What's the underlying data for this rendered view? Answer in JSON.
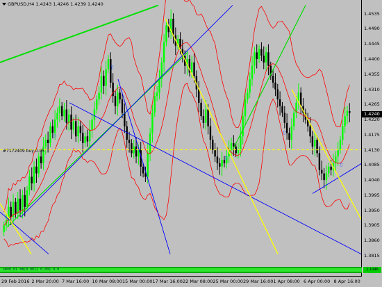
{
  "header": {
    "symbol": "GBPUSD,H4",
    "open": "1.4243",
    "high": "1.4246",
    "low": "1.4239",
    "close": "1.4240"
  },
  "order_label": "#7172409 buy 0.05",
  "current_price": "1.4240",
  "status_text": "sm=0.01 =mL0.0011 0.001 0.0",
  "status_tag": "1.1046",
  "price_axis": {
    "min": 1.3815,
    "max": 1.4555,
    "ticks": [
      "1.4535",
      "1.4490",
      "1.4445",
      "1.4400",
      "1.4355",
      "1.4310",
      "1.4265",
      "1.4220",
      "1.4175",
      "1.4130",
      "1.4085",
      "1.4040",
      "1.3995",
      "1.3950",
      "1.3905",
      "1.3860",
      "1.3815"
    ]
  },
  "time_axis": {
    "ticks": [
      "29 Feb 2016",
      "2 Mar 20:00",
      "7 Mar 16:00",
      "10 Mar 08:00",
      "15 Mar 00:00",
      "17 Mar 16:00",
      "22 Mar 08:00",
      "25 Mar 00:00",
      "29 Mar 16:00",
      "1 Apr 08:00",
      "6 Apr 00:00",
      "8 Apr 16:00"
    ]
  },
  "colors": {
    "background": "#c0c0c0",
    "bull_candle": "#00ff00",
    "bear_candle": "#000000",
    "bollinger": "#ff0000",
    "trend_green": "#00e000",
    "trend_yellow": "#ffff00",
    "trend_blue": "#0000ff",
    "order_line": "#ffff00"
  },
  "chart_data": {
    "type": "candlestick",
    "order_level": 1.413,
    "closes": [
      1.3905,
      1.392,
      1.396,
      1.393,
      1.3975,
      1.394,
      1.3985,
      1.395,
      1.3995,
      1.396,
      1.401,
      1.405,
      1.403,
      1.408,
      1.406,
      1.411,
      1.409,
      1.414,
      1.416,
      1.415,
      1.42,
      1.418,
      1.422,
      1.424,
      1.426,
      1.423,
      1.425,
      1.421,
      1.4235,
      1.419,
      1.4215,
      1.417,
      1.42,
      1.418,
      1.415,
      1.417,
      1.4155,
      1.419,
      1.422,
      1.425,
      1.428,
      1.43,
      1.435,
      1.432,
      1.437,
      1.44,
      1.433,
      1.429,
      1.426,
      1.43,
      1.428,
      1.424,
      1.42,
      1.416,
      1.415,
      1.412,
      1.414,
      1.411,
      1.413,
      1.408,
      1.406,
      1.405,
      1.412,
      1.418,
      1.424,
      1.429,
      1.43,
      1.434,
      1.439,
      1.445,
      1.45,
      1.448,
      1.452,
      1.447,
      1.444,
      1.446,
      1.443,
      1.441,
      1.438,
      1.44,
      1.436,
      1.439,
      1.435,
      1.431,
      1.427,
      1.423,
      1.421,
      1.425,
      1.42,
      1.416,
      1.413,
      1.411,
      1.409,
      1.408,
      1.41,
      1.409,
      1.411,
      1.413,
      1.415,
      1.414,
      1.412,
      1.413,
      1.417,
      1.423,
      1.428,
      1.43,
      1.434,
      1.438,
      1.442,
      1.44,
      1.443,
      1.441,
      1.439,
      1.442,
      1.438,
      1.435,
      1.433,
      1.431,
      1.428,
      1.426,
      1.424,
      1.421,
      1.418,
      1.416,
      1.42,
      1.424,
      1.427,
      1.43,
      1.426,
      1.424,
      1.422,
      1.42,
      1.417,
      1.414,
      1.416,
      1.412,
      1.407,
      1.406,
      1.404,
      1.406,
      1.408,
      1.407,
      1.409,
      1.411,
      1.413,
      1.416,
      1.42,
      1.423,
      1.4245,
      1.424
    ]
  }
}
